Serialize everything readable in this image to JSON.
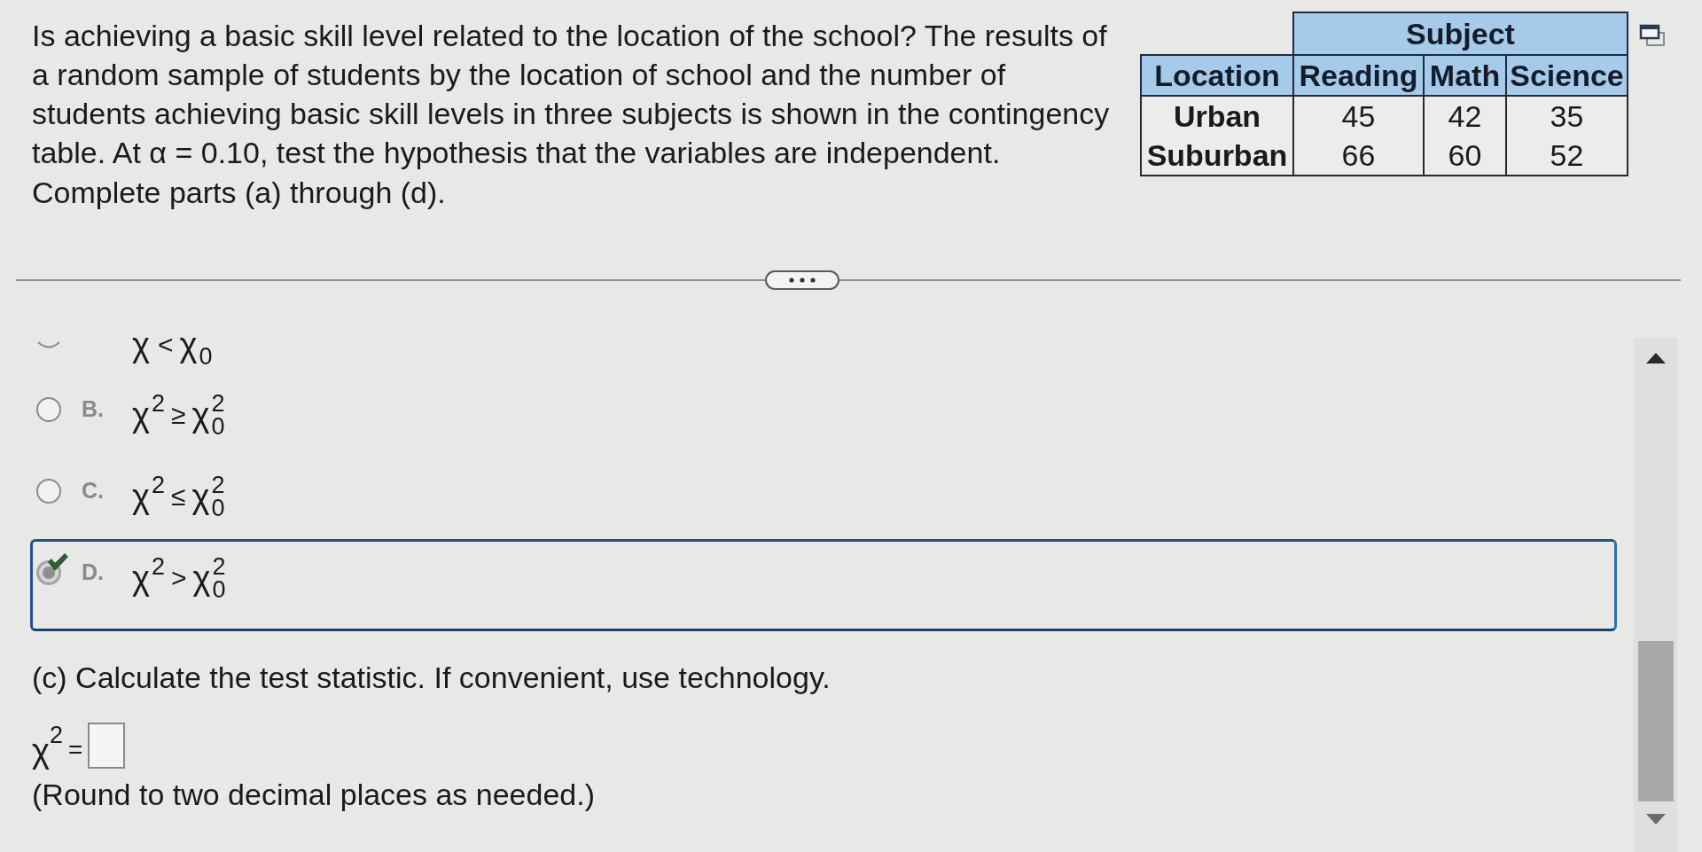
{
  "question": {
    "text": "Is achieving a basic skill level related to the location of the school? The results of a random sample of students by the location of school and the number of students achieving basic skill levels in three subjects is shown in the contingency table. At α = 0.10, test the hypothesis that the variables are independent.",
    "instruction": "Complete parts (a) through (d)."
  },
  "table": {
    "group_header": "Subject",
    "columns": [
      "Location",
      "Reading",
      "Math",
      "Science"
    ],
    "rows": [
      {
        "label": "Urban",
        "values": [
          "45",
          "42",
          "35"
        ]
      },
      {
        "label": "Suburban",
        "values": [
          "66",
          "60",
          "52"
        ]
      }
    ]
  },
  "partial_option": {
    "lhs": "χ",
    "op": "<",
    "rhs": "χ",
    "rhs_sub": "0",
    "selected": false
  },
  "options": [
    {
      "letter": "B.",
      "lhs": "χ",
      "lhs_sup": "2",
      "op": "≥",
      "rhs": "χ",
      "rhs_sup": "2",
      "rhs_sub": "0",
      "selected": false
    },
    {
      "letter": "C.",
      "lhs": "χ",
      "lhs_sup": "2",
      "op": "≤",
      "rhs": "χ",
      "rhs_sup": "2",
      "rhs_sub": "0",
      "selected": false
    },
    {
      "letter": "D.",
      "lhs": "χ",
      "lhs_sup": "2",
      "op": ">",
      "rhs": "χ",
      "rhs_sup": "2",
      "rhs_sub": "0",
      "selected": true
    }
  ],
  "part_c": {
    "prompt": "(c) Calculate the test statistic. If convenient, use technology.",
    "answer": {
      "symbol": "χ",
      "sup": "2",
      "equals": "="
    },
    "note": "(Round to two decimal places as needed.)"
  }
}
